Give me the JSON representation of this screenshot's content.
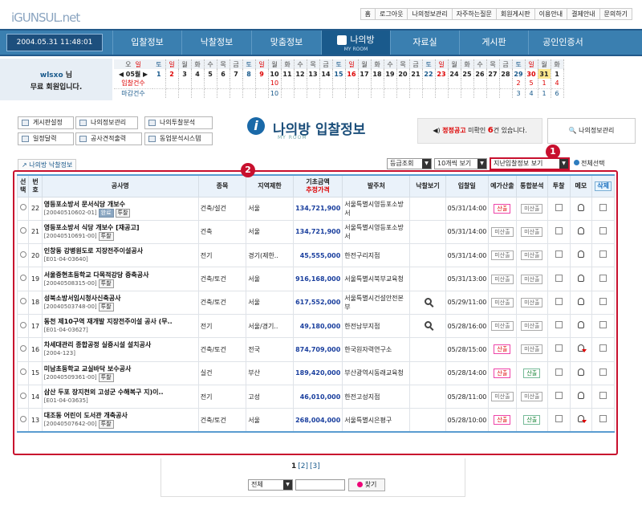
{
  "logo": {
    "main": "iGUNSUL",
    "suffix": ".net"
  },
  "top_links": [
    "홈",
    "로그아웃",
    "나의정보관리",
    "자주하는질문",
    "회원게시판",
    "이용안내",
    "결제안내",
    "문의하기"
  ],
  "clock": "2004.05.31 11:48:01",
  "nav": [
    "입찰정보",
    "낙찰정보",
    "맞춤정보",
    "나의방",
    "자료실",
    "게시판",
    "공인인증서"
  ],
  "nav_active_sub": "MY ROOM",
  "user": {
    "name": "wlsxo",
    "honorific": "님",
    "status": "무료 회원입니다."
  },
  "calendar": {
    "weekdays": [
      "월",
      "화",
      "수",
      "목",
      "금",
      "토",
      "일",
      "월",
      "화",
      "수",
      "목",
      "금",
      "토",
      "일",
      "월",
      "화",
      "수",
      "목",
      "금",
      "토",
      "일",
      "월",
      "화",
      "수",
      "목",
      "금",
      "토",
      "일",
      "월",
      "화",
      "수"
    ],
    "first_weekdays": [
      "오",
      "일",
      "토",
      "일"
    ],
    "month": "05월",
    "days": [
      "1",
      "2",
      "3",
      "4",
      "5",
      "6",
      "7",
      "8",
      "9",
      "10",
      "11",
      "12",
      "13",
      "14",
      "15",
      "16",
      "17",
      "18",
      "19",
      "20",
      "21",
      "22",
      "23",
      "24",
      "25",
      "26",
      "27",
      "28",
      "29",
      "30",
      "31"
    ],
    "row_labels": [
      "입찰건수",
      "마감건수"
    ],
    "bids": {
      "10": "10",
      "29": "2",
      "30": "5",
      "31": "1",
      "32": "4"
    },
    "closes": {
      "10": "10",
      "29": "3",
      "30": "4",
      "31": "1",
      "32": "6"
    }
  },
  "menu": [
    "게시판설정",
    "나의정보관리",
    "나의투찰분석",
    "일정달력",
    "공사견적출력",
    "동업분석시스템"
  ],
  "page": {
    "title": "나의방 입찰정보",
    "sub": "MY ROOM"
  },
  "notice": {
    "label": "정정공고",
    "mid": "미확인",
    "count": "6",
    "suffix": "건 있습니다."
  },
  "manage_button": "나의정보관리",
  "back_link": "나의방 낙찰정보",
  "filters": {
    "sort": "등급조회",
    "per_page": "10개씩 보기",
    "view": "지난입찰정보 보기"
  },
  "select_all": "전체선택",
  "badges": [
    "1",
    "2"
  ],
  "columns": [
    "선택",
    "번호",
    "공사명",
    "종목",
    "지역제한",
    "기초금액",
    "추정가격",
    "발주처",
    "낙찰보기",
    "입찰일",
    "예가산출",
    "통합분석",
    "투찰",
    "메모",
    "삭제"
  ],
  "rows": [
    {
      "no": "22",
      "name": "영등포소방서 문서식당 개보수",
      "code": "[20040510602-01]",
      "tags": [
        "완료",
        "투찰"
      ],
      "type": "건축/설건",
      "region": "서울",
      "amount": "134,721,900",
      "org": "서울특별시영등포소방서",
      "bidview": false,
      "date": "05/31/14:00",
      "calc": "산출",
      "calc_red": true,
      "anal": "미산출",
      "anal_green": false,
      "memo_red": false
    },
    {
      "no": "21",
      "name": "영등포소방서 식당 개보수 [재공고]",
      "code": "[20040510691-00]",
      "tags": [
        "투찰"
      ],
      "type": "건축",
      "region": "서울",
      "amount": "134,721,900",
      "org": "서울특별시영등포소방서",
      "bidview": false,
      "date": "05/31/14:00",
      "calc": "미산출",
      "calc_red": false,
      "anal": "미산출",
      "anal_green": false,
      "memo_red": false
    },
    {
      "no": "20",
      "name": "인창동 강병원도로 지장전주이설공사",
      "code": "[E01-04-03640]",
      "tags": [],
      "type": "전기",
      "region": "경기(제한..",
      "amount": "45,555,000",
      "org": "한전구리지점",
      "bidview": false,
      "date": "05/31/14:00",
      "calc": "미산출",
      "calc_red": false,
      "anal": "미산출",
      "anal_green": false,
      "memo_red": false
    },
    {
      "no": "19",
      "name": "서울중현초등학교 다목적강당 증축공사",
      "code": "[20040508315-00]",
      "tags": [
        "투찰"
      ],
      "type": "건축/토건",
      "region": "서울",
      "amount": "916,168,000",
      "org": "서울특별시북부교육청",
      "bidview": false,
      "date": "05/31/13:00",
      "calc": "미산출",
      "calc_red": false,
      "anal": "미산출",
      "anal_green": false,
      "memo_red": false
    },
    {
      "no": "18",
      "name": "성북소방서임시청사신축공사",
      "code": "[20040503748-00]",
      "tags": [
        "투찰"
      ],
      "type": "건축/토건",
      "region": "서울",
      "amount": "617,552,000",
      "org": "서울특별시건설안전본부",
      "bidview": true,
      "date": "05/29/11:00",
      "calc": "미산출",
      "calc_red": false,
      "anal": "미산출",
      "anal_green": false,
      "memo_red": false
    },
    {
      "no": "17",
      "name": "동천 제10구역 재개발 지장전주이설 공사 (무..",
      "code": "[E01-04-03627]",
      "tags": [],
      "type": "전기",
      "region": "서울/경기..",
      "amount": "49,180,000",
      "org": "한전남부지점",
      "bidview": true,
      "date": "05/28/16:00",
      "calc": "미산출",
      "calc_red": false,
      "anal": "미산출",
      "anal_green": false,
      "memo_red": false
    },
    {
      "no": "16",
      "name": "차세대관리 종합공정 실증시설 설치공사",
      "code": "[2004-123]",
      "tags": [],
      "type": "건축/토건",
      "region": "전국",
      "amount": "874,709,000",
      "org": "한국원자력연구소",
      "bidview": false,
      "date": "05/28/15:00",
      "calc": "산출",
      "calc_red": true,
      "anal": "미산출",
      "anal_green": false,
      "memo_red": true
    },
    {
      "no": "15",
      "name": "미남초등학교 교실바닥 보수공사",
      "code": "[20040509361-00]",
      "tags": [
        "투찰"
      ],
      "type": "실건",
      "region": "부산",
      "amount": "189,420,000",
      "org": "부산광역시동래교육청",
      "bidview": false,
      "date": "05/28/14:00",
      "calc": "산출",
      "calc_red": true,
      "anal": "산출",
      "anal_green": true,
      "memo_red": false
    },
    {
      "no": "14",
      "name": "삼산 두포 장지천외 고성군 수해복구 지)이..",
      "code": "[E01-04-03635]",
      "tags": [],
      "type": "전기",
      "region": "고성",
      "amount": "46,010,000",
      "org": "한전고성지점",
      "bidview": false,
      "date": "05/28/11:00",
      "calc": "미산출",
      "calc_red": false,
      "anal": "미산출",
      "anal_green": false,
      "memo_red": false
    },
    {
      "no": "13",
      "name": "대조동 어린이 도서관 개축공사",
      "code": "[20040507642-00]",
      "tags": [
        "투찰"
      ],
      "type": "건축/토건",
      "region": "서울",
      "amount": "268,004,000",
      "org": "서울특별시은평구",
      "bidview": false,
      "date": "05/28/10:00",
      "calc": "산출",
      "calc_red": true,
      "anal": "산출",
      "anal_green": true,
      "memo_red": true
    }
  ],
  "pager": {
    "pages": [
      "1",
      "[2]",
      "[3]"
    ]
  },
  "search": {
    "scope": "전체",
    "button": "찾기"
  }
}
